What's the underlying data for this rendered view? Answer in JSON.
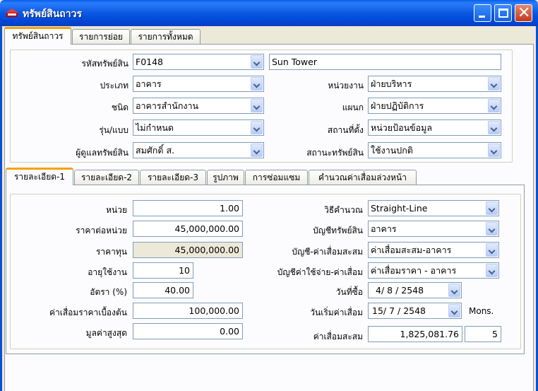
{
  "window": {
    "title": "ทรัพย์สินถาวร",
    "colors": {
      "titlebar": "#0a58e0",
      "active_tab_accent": "#f2a30f",
      "close_button": "#c0391c"
    }
  },
  "top_tabs": [
    {
      "label": "ทรัพย์สินถาวร",
      "active": true
    },
    {
      "label": "รายการย่อย",
      "active": false
    },
    {
      "label": "รายการทั้งหมด",
      "active": false
    }
  ],
  "header": {
    "asset_code_label": "รหัสทรัพย์สิน",
    "asset_code_value": "F0148",
    "asset_name_value": "Sun Tower",
    "type_label": "ประเภท",
    "type_value": "อาคาร",
    "unit_label": "หน่วยงาน",
    "unit_value": "ฝ่ายบริหาร",
    "kind_label": "ชนิด",
    "kind_value": "อาคารสำนักงาน",
    "department_label": "แผนก",
    "department_value": "ฝ่ายปฏิบัติการ",
    "model_label": "รุ่น/แบบ",
    "model_value": "ไม่กำหนด",
    "location_label": "สถานที่ตั้ง",
    "location_value": "หน่วยป้อนข้อมูล",
    "custodian_label": "ผู้ดูแลทรัพย์สิน",
    "custodian_value": "สมศักดิ์ ส.",
    "status_label": "สถานะทรัพย์สิน",
    "status_value": "ใช้งานปกติ"
  },
  "detail_tabs": [
    {
      "label": "รายละเอียด-1",
      "active": true
    },
    {
      "label": "รายละเอียด-2",
      "active": false
    },
    {
      "label": "รายละเอียด-3",
      "active": false
    },
    {
      "label": "รูปภาพ",
      "active": false
    },
    {
      "label": "การซ่อมแซม",
      "active": false
    },
    {
      "label": "คำนวณค่าเสื่อมล่วงหน้า",
      "active": false
    }
  ],
  "details": {
    "quantity_label": "หน่วย",
    "quantity_value": "1.00",
    "unit_price_label": "ราคาต่อหน่วย",
    "unit_price_value": "45,000,000.00",
    "cost_label": "ราคาทุน",
    "cost_value": "45,000,000.00",
    "useful_life_label": "อายุใช้งาน",
    "useful_life_value": "10",
    "rate_label": "อัตรา (%)",
    "rate_value": "40.00",
    "initial_depreciation_label": "ค่าเสื่อมราคาเบื้องต้น",
    "initial_depreciation_value": "100,000.00",
    "max_value_label": "มูลค่าสูงสุด",
    "max_value_value": "0.00",
    "method_label": "วิธีคำนวณ",
    "method_value": "Straight-Line",
    "asset_account_label": "บัญชีทรัพย์สิน",
    "asset_account_value": "อาคาร",
    "accum_dep_account_label": "บัญชี-ค่าเสื่อมสะสม",
    "accum_dep_account_value": "ค่าเสื่อมสะสม-อาคาร",
    "dep_expense_account_label": "บัญชีค่าใช้จ่าย-ค่าเสื่อม",
    "dep_expense_account_value": "ค่าเสื่อมราคา - อาคาร",
    "purchase_date_label": "วันที่ซื้อ",
    "purchase_date_value": "4/ 8 / 2548",
    "dep_start_label": "วันเริ่มค่าเสื่อม",
    "dep_start_value": "15/ 7 / 2548",
    "months_label": "Mons.",
    "accum_dep_label": "ค่าเสื่อมสะสม",
    "accum_dep_value": "1,825,081.76",
    "months_value": "5"
  }
}
